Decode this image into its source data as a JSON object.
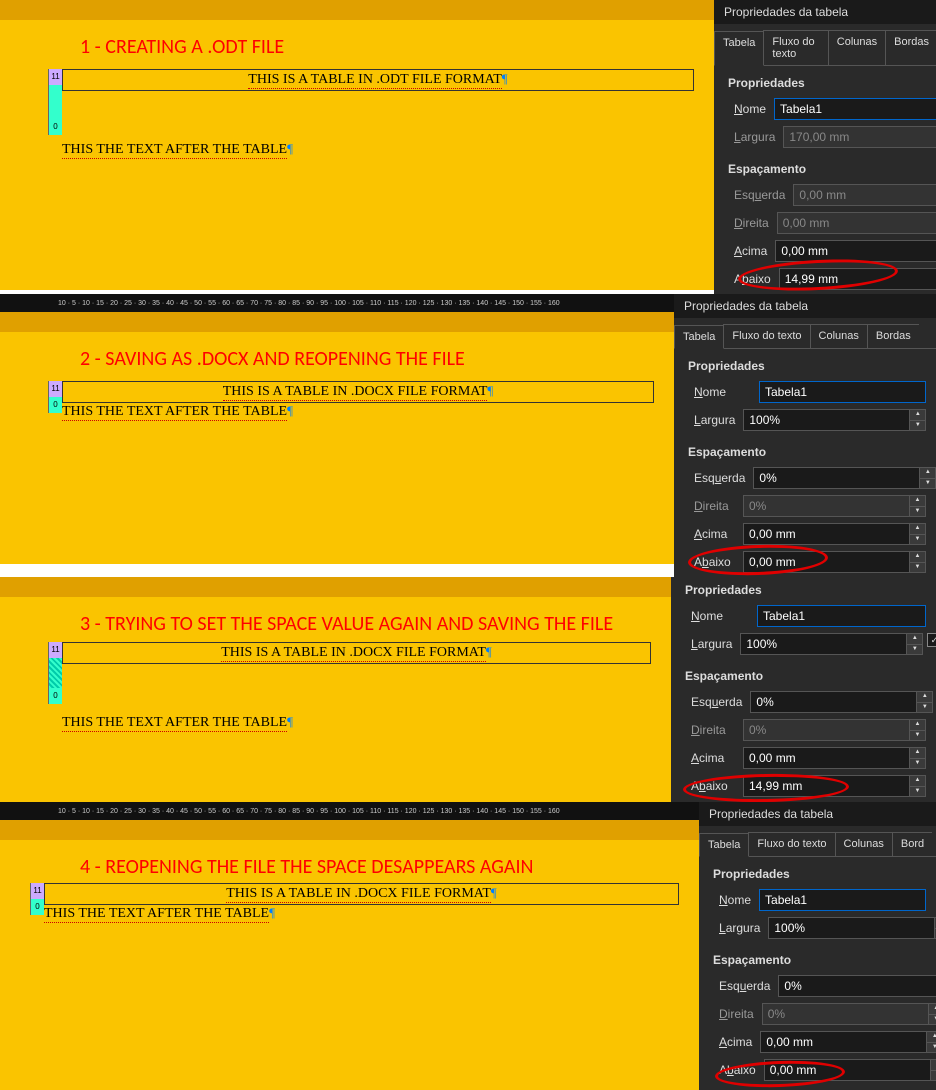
{
  "ruler_marks": "10 · 5 · 10 · 15 · 20 · 25 · 30 · 35 · 40 · 45 · 50 · 55 · 60 · 65 · 70 · 75 · 80 · 85 · 90 · 95 · 100 · 105 · 110 · 115 · 120 · 125 · 130 · 135 · 140 · 145 · 150 · 155 · 160",
  "panel_title": "Propriedades da tabela",
  "tabs": {
    "tabela": "Tabela",
    "fluxo": "Fluxo do texto",
    "colunas": "Colunas",
    "bordas": "Bordas"
  },
  "labels": {
    "propriedades": "Propriedades",
    "nome": "Nome",
    "largura": "Largura",
    "espacamento": "Espaçamento",
    "esquerda": "Esquerda",
    "direita": "Direita",
    "acima": "Acima",
    "abaixo": "Abaixo",
    "gutter_11": "11",
    "gutter_0": "0"
  },
  "section1": {
    "title": "1 - CREATING A .ODT FILE",
    "table_text": "THIS IS A TABLE IN .ODT FILE FORMAT",
    "body_text": "THIS THE TEXT AFTER THE TABLE",
    "nome": "Tabela1",
    "largura": "170,00 mm",
    "esquerda": "0,00 mm",
    "direita": "0,00 mm",
    "acima": "0,00 mm",
    "abaixo": "14,99 mm"
  },
  "section2": {
    "title": "2 - SAVING AS .DOCX AND REOPENING THE FILE",
    "table_text": "THIS IS A TABLE IN .DOCX FILE FORMAT",
    "body_text": "THIS THE TEXT AFTER THE TABLE",
    "nome": "Tabela1",
    "largura": "100%",
    "esquerda": "0%",
    "direita": "0%",
    "acima": "0,00 mm",
    "abaixo": "0,00 mm"
  },
  "section3": {
    "title": "3 - TRYING TO SET THE SPACE VALUE AGAIN AND SAVING THE FILE",
    "table_text": "THIS IS A TABLE IN .DOCX FILE FORMAT",
    "body_text": "THIS THE TEXT AFTER THE TABLE",
    "nome": "Tabela1",
    "largura": "100%",
    "esquerda": "0%",
    "direita": "0%",
    "acima": "0,00 mm",
    "abaixo": "14,99 mm"
  },
  "section4": {
    "title": "4 - REOPENING THE FILE THE SPACE DESAPPEARS AGAIN",
    "table_text": "THIS IS A TABLE IN .DOCX FILE FORMAT",
    "body_text": "THIS THE TEXT AFTER THE TABLE",
    "nome": "Tabela1",
    "largura": "100%",
    "esquerda": "0%",
    "direita": "0%",
    "acima": "0,00 mm",
    "abaixo": "0,00 mm"
  }
}
